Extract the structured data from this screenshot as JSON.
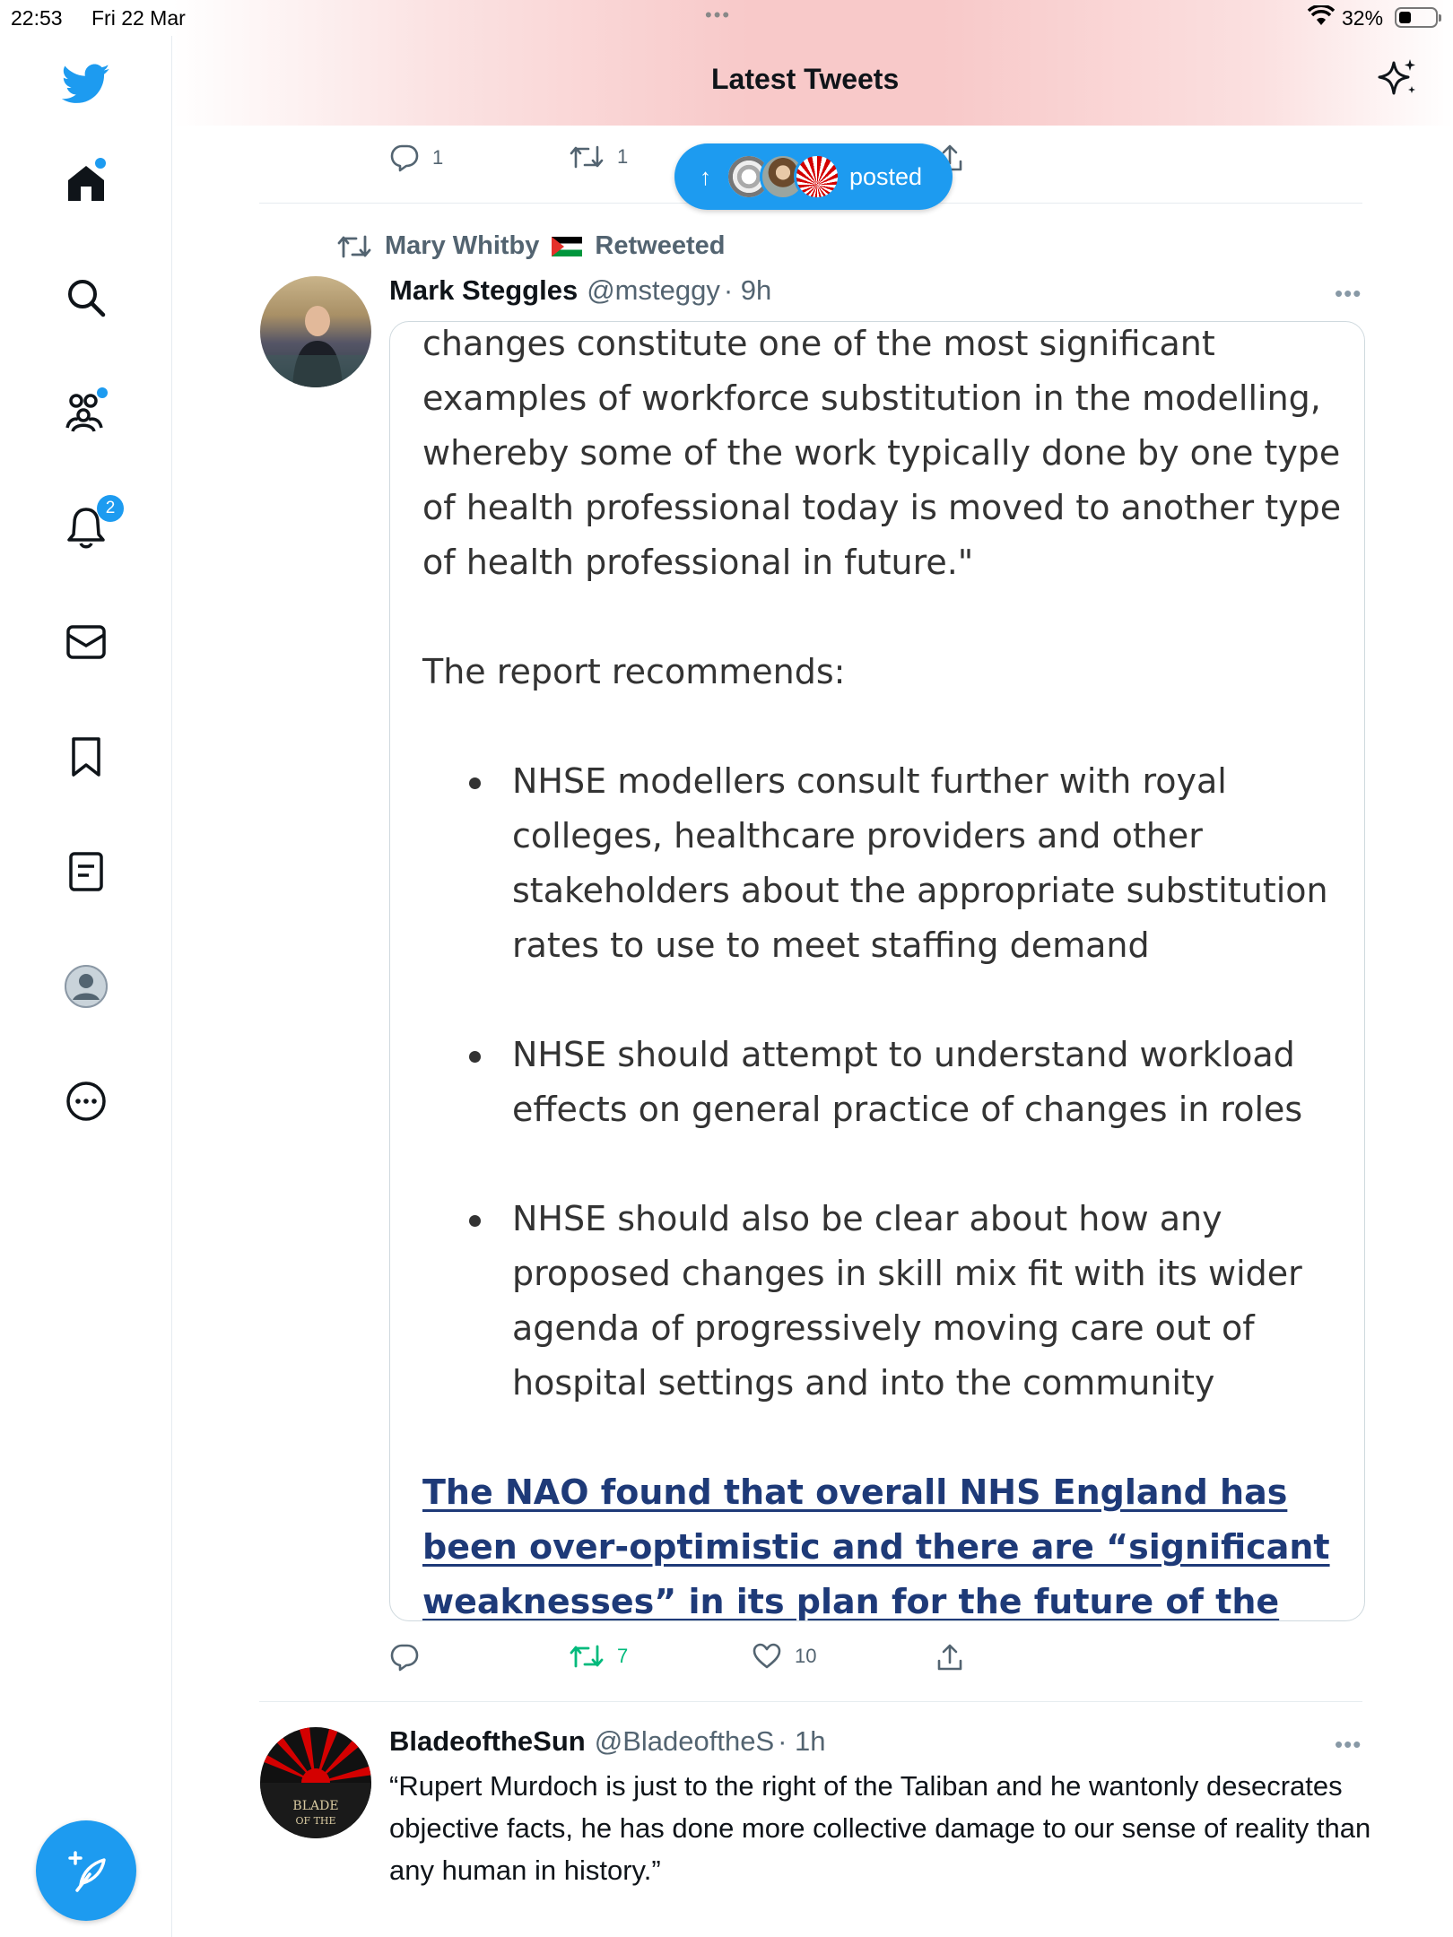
{
  "status_bar": {
    "time": "22:53",
    "date": "Fri 22 Mar",
    "battery": "32%"
  },
  "header": {
    "title": "Latest Tweets"
  },
  "sidebar": {
    "notifications_count": "2",
    "items": [
      "twitter-logo",
      "home-icon",
      "search-icon",
      "communities-icon",
      "notifications-icon",
      "messages-icon",
      "bookmarks-icon",
      "lists-icon",
      "profile-icon",
      "more-icon"
    ]
  },
  "posted_pill": {
    "label": "posted"
  },
  "prev_tweet_actions": {
    "replies": "1",
    "retweets": "1"
  },
  "retweet_context": {
    "retweeter": "Mary Whitby",
    "label": "Retweeted"
  },
  "tweet1": {
    "name": "Mark Steggles",
    "handle": "@msteggy",
    "time": "· 9h",
    "media": {
      "lines_top": [
        "changes constitute one of the most significant",
        "examples of workforce substitution in the modelling,",
        "whereby some of the work typically done by one type",
        "of health professional today is moved to another type",
        "of health professional in future.\""
      ],
      "intro": "The report recommends:",
      "bullets": [
        "NHSE modellers consult further with royal colleges, healthcare providers and other stakeholders about the appropriate substitution rates to use to meet staffing demand",
        "NHSE should attempt to understand workload effects on general practice of changes in roles",
        "NHSE should also be clear about how any proposed changes in skill mix fit with its wider agenda of progressively moving care out of hospital settings and into the community"
      ],
      "link": "The NAO found that overall NHS England has been over-optimistic and there are “significant weaknesses” in its plan for the future of the"
    },
    "actions": {
      "replies": "",
      "retweets": "7",
      "likes": "10"
    }
  },
  "tweet2": {
    "name": "BladeoftheSun",
    "handle": "@BladeoftheS",
    "time": "· 1h",
    "text": "“Rupert Murdoch is just to the right of the Taliban and he wantonly desecrates objective facts, he has done more collective damage to our sense of reality than any human in history.”"
  },
  "colors": {
    "accent": "#1d9bf0",
    "retweet_green": "#00ba7c",
    "secondary_text": "#536471",
    "link": "#1e3a78"
  }
}
